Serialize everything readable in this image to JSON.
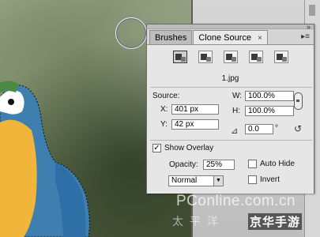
{
  "panel": {
    "tabs": [
      {
        "label": "Brushes"
      },
      {
        "label": "Clone Source",
        "close": "×"
      }
    ],
    "collapse_glyph": "»",
    "menu_glyph": "▸≡",
    "source_icons": [
      "clone-source-1-icon",
      "clone-source-2-icon",
      "clone-source-3-icon",
      "clone-source-4-icon",
      "clone-source-5-icon"
    ],
    "filename": "1.jpg",
    "offset_section": {
      "label": "Source:",
      "x_label": "X:",
      "x_value": "401 px",
      "y_label": "Y:",
      "y_value": "42 px",
      "w_label": "W:",
      "w_value": "100.0%",
      "h_label": "H:",
      "h_value": "100.0%",
      "angle_value": "0.0",
      "degree_symbol": "°"
    },
    "overlay": {
      "show_overlay_label": "Show Overlay",
      "show_overlay_checked": "✓",
      "opacity_label": "Opacity:",
      "opacity_value": "25%",
      "blend_mode": "Normal",
      "auto_hide_label": "Auto Hide",
      "invert_label": "Invert"
    }
  },
  "watermark": {
    "english": "PConline.com.cn",
    "chinese": "太平洋",
    "brand": "京华手游"
  },
  "colors": {
    "panel_bg": "#e6e6e6",
    "tab_active": "#e9e9e9",
    "canvas_edge": "#d6d6d6"
  }
}
